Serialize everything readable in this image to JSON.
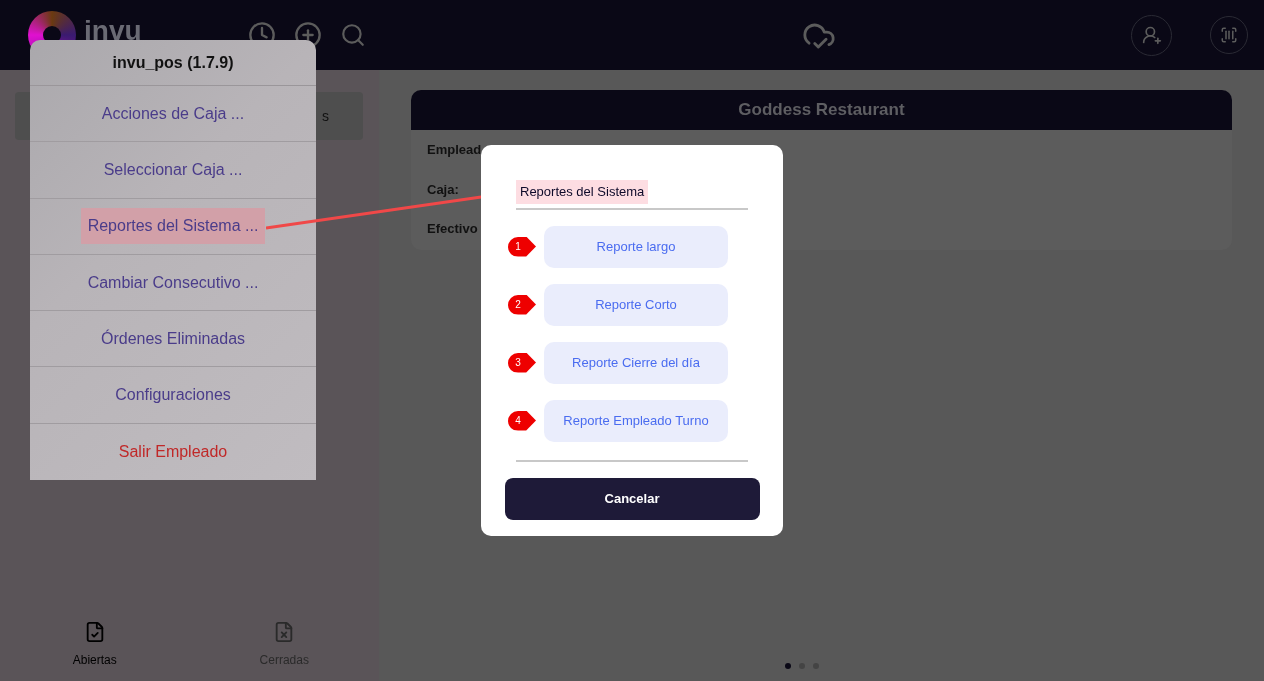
{
  "header": {
    "logo_text": "invu"
  },
  "sidebar": {
    "button_text": "s",
    "tabs": [
      {
        "label": "Abiertas",
        "selected": true,
        "kind": "open"
      },
      {
        "label": "Cerradas",
        "selected": false,
        "kind": "closed"
      }
    ]
  },
  "card": {
    "title": "Goddess Restaurant",
    "rows": [
      "Emplead",
      "Caja:",
      "Efectivo"
    ]
  },
  "pager": [
    {
      "selected": true
    },
    {
      "selected": false
    },
    {
      "selected": false
    }
  ],
  "menu": {
    "title": "invu_pos (1.7.9)",
    "items": [
      {
        "label": "Acciones de Caja ...",
        "highlighted": false,
        "danger": false
      },
      {
        "label": "Seleccionar Caja ...",
        "highlighted": false,
        "danger": false
      },
      {
        "label": "Reportes del Sistema ...",
        "highlighted": true,
        "danger": false
      },
      {
        "label": "Cambiar Consecutivo ...",
        "highlighted": false,
        "danger": false
      },
      {
        "label": "Órdenes Eliminadas",
        "highlighted": false,
        "danger": false
      },
      {
        "label": "Configuraciones",
        "highlighted": false,
        "danger": false
      },
      {
        "label": "Salir Empleado",
        "highlighted": false,
        "danger": true
      }
    ]
  },
  "dialog": {
    "title": "Reportes del Sistema",
    "options": [
      {
        "marker": "1",
        "label": "Reporte largo"
      },
      {
        "marker": "2",
        "label": "Reporte Corto"
      },
      {
        "marker": "3",
        "label": "Reporte Cierre del día"
      },
      {
        "marker": "4",
        "label": "Reporte Empleado Turno"
      }
    ],
    "cancel": "Cancelar"
  }
}
